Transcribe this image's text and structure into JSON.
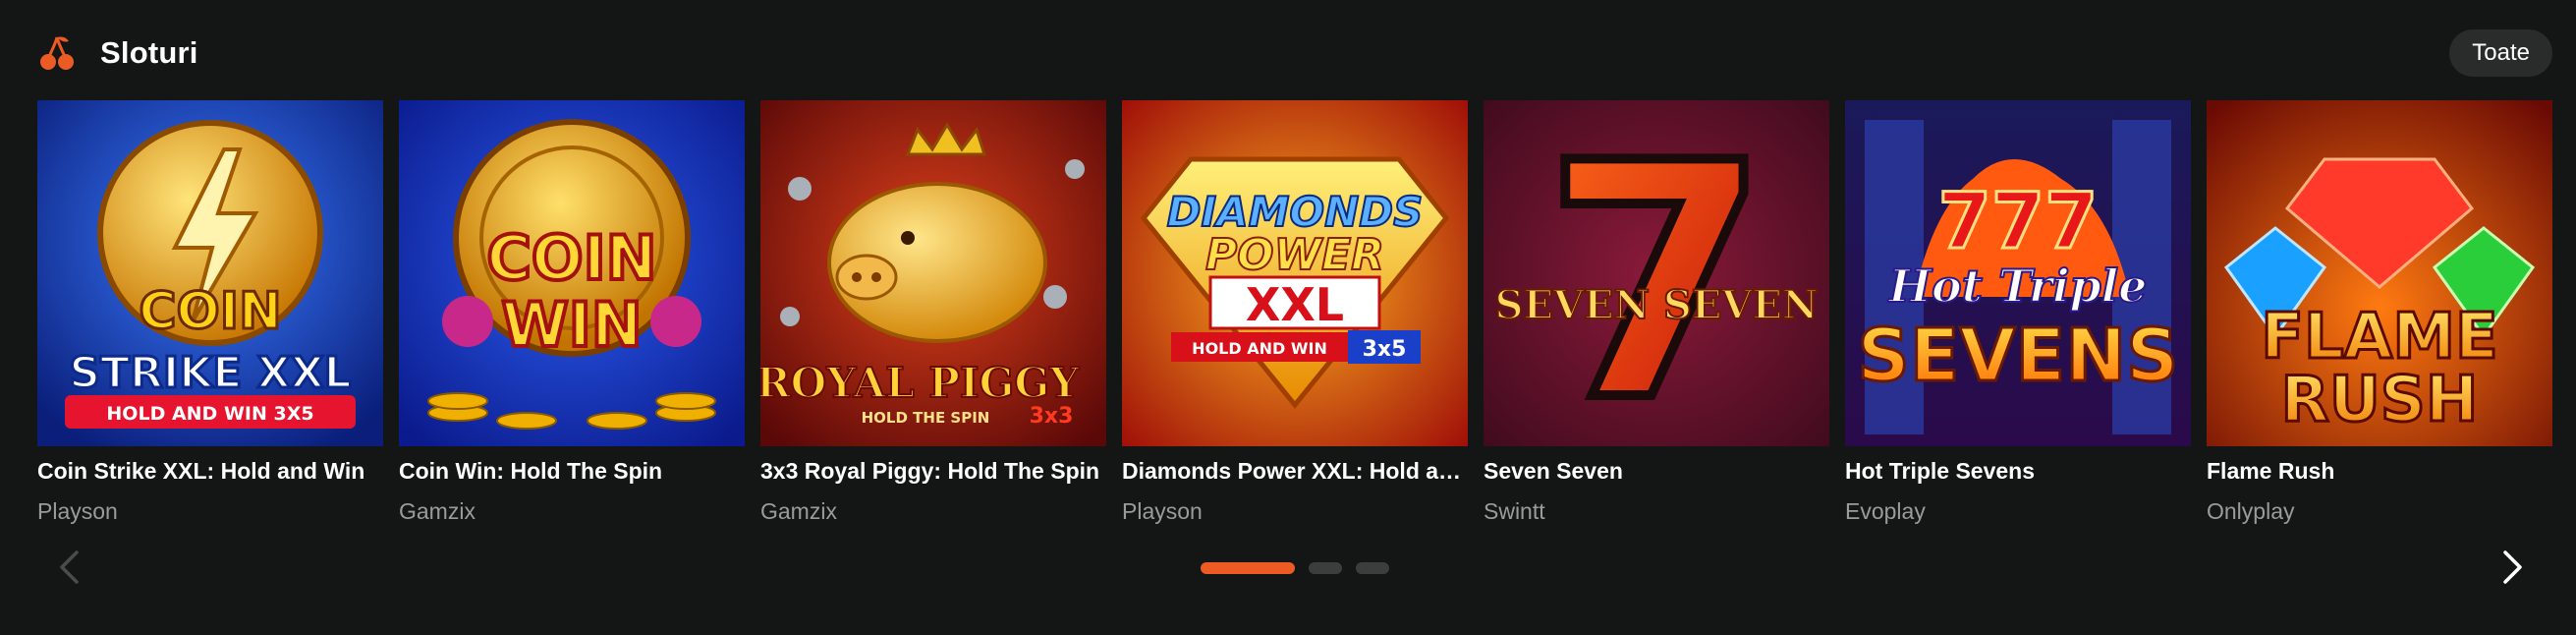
{
  "section": {
    "title": "Sloturi",
    "icon": "cherries-icon",
    "all_label": "Toate"
  },
  "colors": {
    "background": "#141616",
    "accent": "#ec5b24",
    "provider_text": "#9a9c9c"
  },
  "games": [
    {
      "title": "Coin Strike XXL: Hold and Win",
      "provider": "Playson",
      "art": [
        "COIN",
        "STRIKE XXL",
        "HOLD AND WIN 3X5"
      ]
    },
    {
      "title": "Coin Win: Hold The Spin",
      "provider": "Gamzix",
      "art": [
        "COIN",
        "WIN"
      ]
    },
    {
      "title": "3x3 Royal Piggy: Hold The Spin",
      "provider": "Gamzix",
      "art": [
        "ROYAL PIGGY",
        "3x3",
        "HOLD THE SPIN"
      ]
    },
    {
      "title": "Diamonds Power XXL: Hold and Win",
      "provider": "Playson",
      "art": [
        "DIAMONDS",
        "POWER",
        "XXL",
        "HOLD AND WIN",
        "3x5"
      ]
    },
    {
      "title": "Seven Seven",
      "provider": "Swintt",
      "art": [
        "7",
        "SEVEN SEVEN"
      ]
    },
    {
      "title": "Hot Triple Sevens",
      "provider": "Evoplay",
      "art": [
        "777",
        "Hot Triple",
        "SEVENS"
      ]
    },
    {
      "title": "Flame Rush",
      "provider": "Onlyplay",
      "art": [
        "FLAME",
        "RUSH"
      ]
    }
  ],
  "pagination": {
    "pages": 3,
    "active_page": 1
  }
}
